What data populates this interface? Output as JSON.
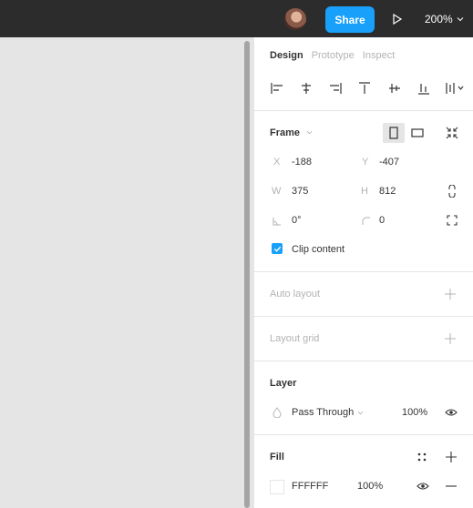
{
  "topbar": {
    "share_label": "Share",
    "zoom_value": "200%"
  },
  "panel": {
    "tabs": [
      {
        "label": "Design",
        "active": true
      },
      {
        "label": "Prototype",
        "active": false
      },
      {
        "label": "Inspect",
        "active": false
      }
    ],
    "frame": {
      "title": "Frame",
      "x_label": "X",
      "x_value": "-188",
      "y_label": "Y",
      "y_value": "-407",
      "w_label": "W",
      "w_value": "375",
      "h_label": "H",
      "h_value": "812",
      "rotation_value": "0°",
      "radius_value": "0",
      "clip_label": "Clip content",
      "clip_checked": true
    },
    "auto_layout": {
      "title": "Auto layout"
    },
    "layout_grid": {
      "title": "Layout grid"
    },
    "layer": {
      "title": "Layer",
      "blend_mode": "Pass Through",
      "opacity": "100%"
    },
    "fill": {
      "title": "Fill",
      "color_hex": "FFFFFF",
      "opacity": "100%"
    }
  },
  "colors": {
    "toolbar_bg": "#2c2c2c",
    "accent": "#18a0fb",
    "canvas_bg": "#e5e5e5",
    "panel_bg": "#ffffff",
    "text": "#333333",
    "muted": "#b3b3b3",
    "fill_swatch": "#ffffff"
  },
  "icons": [
    "avatar",
    "play-icon",
    "chevron-down-icon",
    "align-left-icon",
    "align-horizontal-center-icon",
    "align-right-icon",
    "align-top-icon",
    "align-vertical-center-icon",
    "align-bottom-icon",
    "distribute-icon",
    "portrait-frame-icon",
    "landscape-frame-icon",
    "resize-to-fit-icon",
    "constrain-proportions-icon",
    "rotation-icon",
    "corner-radius-icon",
    "independent-corners-icon",
    "checkmark-icon",
    "plus-icon",
    "blend-mode-icon",
    "eye-icon",
    "styles-icon",
    "minus-icon"
  ]
}
